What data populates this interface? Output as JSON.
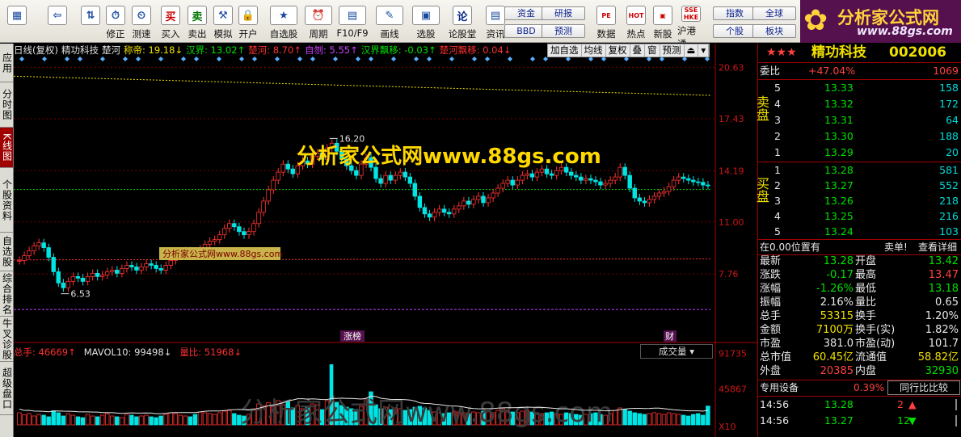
{
  "toolbar": {
    "buttons": [
      {
        "label": "",
        "icon": "grid-icon"
      },
      {
        "label": "",
        "icon": "back-arrow-icon"
      },
      {
        "label": "",
        "icon": "up-down-arrows-icon"
      },
      {
        "label": "修正",
        "icon": "clock-icon"
      },
      {
        "label": "测速",
        "icon": "stopwatch-icon"
      },
      {
        "label": "买入",
        "icon": "buy-icon",
        "glyph": "买"
      },
      {
        "label": "卖出",
        "icon": "sell-icon",
        "glyph": "卖"
      },
      {
        "label": "模拟",
        "icon": "hammer-icon"
      },
      {
        "label": "开户",
        "icon": "lock-icon"
      },
      {
        "label": "自选股",
        "icon": "star-icon"
      },
      {
        "label": "周期",
        "icon": "clock-icon"
      },
      {
        "label": "F10/F9",
        "icon": "f10-icon"
      },
      {
        "label": "画线",
        "icon": "pencil-icon"
      },
      {
        "label": "选股",
        "icon": "picture-icon"
      },
      {
        "label": "论股堂",
        "icon": "discuss-icon",
        "glyph": "论"
      },
      {
        "label": "资讯",
        "icon": "document-icon"
      }
    ],
    "small_buttons": [
      "资金",
      "BBD",
      "研报",
      "预测",
      "指数",
      "个股",
      "全球",
      "板块"
    ],
    "big_buttons_2": [
      {
        "label": "数据",
        "icon": "pe-icon",
        "glyph": "PE"
      },
      {
        "label": "热点",
        "icon": "hot-icon",
        "glyph": "HOT"
      },
      {
        "label": "新股",
        "icon": "new-icon"
      },
      {
        "label": "沪港通",
        "icon": "sse-hke-icon",
        "glyph": "SSE HKE"
      }
    ],
    "logo_title": "分析家公式网",
    "logo_url": "www.88gs.com"
  },
  "sidetabs": [
    "应用",
    "分时图",
    "K线图",
    "个股资料",
    "自选股",
    "综合排名",
    "牛叉诊股",
    "超级盘口"
  ],
  "chart": {
    "title_items": [
      {
        "text": "日线(复权)",
        "color": "#e0e0e0"
      },
      {
        "text": "精功科技",
        "color": "#e0e0e0"
      },
      {
        "text": "楚河",
        "color": "#e8e8e8"
      },
      {
        "text": "称帝: 19.18↓",
        "color": "#f0e000"
      },
      {
        "text": "汉界: 13.02↑",
        "color": "#00e000"
      },
      {
        "text": "楚河: 8.70↑",
        "color": "#ff3030"
      },
      {
        "text": "自刎: 5.55↑",
        "color": "#d040ff"
      },
      {
        "text": "汉界飘移: -0.03↑",
        "color": "#00e000"
      },
      {
        "text": "楚河飘移: 0.04↓",
        "color": "#ff3030"
      }
    ],
    "tools": [
      "加自选",
      "均线",
      "复权",
      "叠",
      "窗",
      "预测",
      "⏏",
      "▾"
    ],
    "price_labels": [
      "20.63",
      "17.43",
      "14.19",
      "11.00",
      "7.76"
    ],
    "high_label": "16.20",
    "low_label": "6.53",
    "watermark": "分析家公式网www.88gs.com",
    "watermark_small": "分析家公式网www.88gs.com",
    "watermark_vol": "分析家公式网www.88gs.com",
    "tag_zhangbang": "涨榜",
    "tag_cai": "财",
    "vol_legend": [
      {
        "text": "总手: 46669↑",
        "color": "#ff3030"
      },
      {
        "text": "MAVOL10: 99498↓",
        "color": "#e0e0e0"
      },
      {
        "text": "量比: 51968↓",
        "color": "#ff3030"
      }
    ],
    "vol_dropdown": "成交量",
    "vol_labels": [
      "91735",
      "45867",
      "X10"
    ],
    "colors": {
      "up": "#ff3232",
      "down": "#00e4e4",
      "grid": "#7a0000"
    }
  },
  "chart_data": {
    "type": "candlestick",
    "price_ticks": [
      20.63,
      17.43,
      14.19,
      11.0,
      7.76
    ],
    "high": 16.2,
    "low": 6.53,
    "lines": [
      {
        "name": "称帝",
        "value": 19.18
      },
      {
        "name": "汉界",
        "value": 13.02
      },
      {
        "name": "楚河",
        "value": 8.7
      },
      {
        "name": "自刎",
        "value": 5.55
      }
    ],
    "close": [
      8.6,
      8.9,
      9.2,
      9.5,
      9.7,
      9.4,
      8.8,
      7.9,
      7.2,
      6.9,
      7.3,
      7.6,
      7.5,
      7.3,
      7.6,
      7.8,
      7.6,
      7.7,
      7.9,
      8.0,
      7.8,
      8.1,
      8.3,
      8.2,
      8.0,
      8.2,
      8.4,
      8.3,
      8.1,
      8.0,
      8.3,
      8.6,
      8.9,
      9.1,
      9.2,
      9.0,
      8.9,
      9.3,
      9.6,
      9.8,
      9.9,
      10.2,
      10.6,
      10.9,
      10.7,
      10.4,
      10.2,
      10.4,
      10.9,
      11.6,
      12.3,
      13.0,
      13.6,
      14.1,
      14.6,
      14.3,
      14.0,
      14.5,
      14.8,
      14.6,
      15.1,
      15.3,
      14.9,
      15.6,
      15.9,
      15.4,
      14.9,
      14.5,
      14.2,
      13.9,
      14.6,
      15.0,
      14.4,
      13.7,
      13.4,
      13.9,
      13.6,
      13.9,
      14.1,
      13.8,
      13.4,
      12.6,
      11.9,
      11.5,
      11.3,
      11.6,
      11.8,
      11.6,
      11.5,
      11.8,
      12.0,
      12.3,
      12.1,
      12.4,
      12.6,
      12.2,
      12.5,
      12.8,
      13.1,
      13.4,
      13.6,
      13.3,
      13.6,
      13.9,
      14.0,
      13.8,
      14.1,
      14.3,
      14.0,
      13.9,
      14.2,
      14.4,
      14.1,
      13.9,
      13.8,
      13.6,
      13.7,
      13.6,
      13.5,
      13.3,
      13.4,
      13.6,
      13.8,
      14.4,
      13.9,
      13.1,
      12.5,
      12.3,
      12.2,
      12.4,
      12.6,
      12.8,
      12.9,
      13.2,
      13.6,
      13.8,
      13.7,
      13.6,
      13.5,
      13.47,
      13.3,
      13.28
    ],
    "volume": [
      30000,
      25000,
      28000,
      22000,
      26000,
      24000,
      20000,
      35000,
      30000,
      22000,
      28000,
      24000,
      20000,
      18000,
      26000,
      22000,
      20000,
      24000,
      28000,
      22000,
      20000,
      18000,
      26000,
      24000,
      20000,
      22000,
      24000,
      20000,
      18000,
      22000,
      26000,
      30000,
      28000,
      24000,
      22000,
      20000,
      26000,
      32000,
      30000,
      28000,
      26000,
      30000,
      34000,
      36000,
      28000,
      24000,
      22000,
      26000,
      40000,
      52000,
      48000,
      55000,
      45000,
      60000,
      50000,
      58000,
      42000,
      48000,
      40000,
      45000,
      52000,
      50000,
      38000,
      60000,
      72000,
      56000,
      48000,
      44000,
      40000,
      38000,
      46000,
      64000,
      82000,
      50000,
      40000,
      44000,
      38000,
      42000,
      40000,
      36000,
      38000,
      44000,
      46000,
      42000,
      36000,
      32000,
      30000,
      28000,
      30000,
      34000,
      32000,
      30000,
      28000,
      32000,
      30000,
      34000,
      32000,
      30000,
      36000,
      40000,
      34000,
      32000,
      30000,
      34000,
      36000,
      32000,
      30000,
      28000,
      30000,
      32000,
      28000,
      26000,
      30000,
      28000,
      26000,
      24000,
      26000,
      28000,
      30000,
      26000,
      24000,
      28000,
      36000,
      42000,
      38000,
      34000,
      30000,
      28000,
      26000,
      28000,
      30000,
      28000,
      26000,
      30000,
      28000,
      26000,
      24000,
      22000,
      26000,
      28000,
      24000,
      46669
    ],
    "vol_ticks": [
      91735,
      45867
    ],
    "vol_peak": 180000
  },
  "right": {
    "stars": "★★★",
    "stock_name": "精功科技",
    "stock_code": "002006",
    "weibi_label": "委比",
    "weibi_value": "+47.04%",
    "weibi_diff": "1069",
    "sell_side_label": "卖盘",
    "buy_side_label": "买盘",
    "sell_orders": [
      {
        "level": "5",
        "price": "13.33",
        "volume": "158"
      },
      {
        "level": "4",
        "price": "13.32",
        "volume": "172"
      },
      {
        "level": "3",
        "price": "13.31",
        "volume": "64"
      },
      {
        "level": "2",
        "price": "13.30",
        "volume": "188"
      },
      {
        "level": "1",
        "price": "13.29",
        "volume": "20"
      }
    ],
    "buy_orders": [
      {
        "level": "1",
        "price": "13.28",
        "volume": "581"
      },
      {
        "level": "2",
        "price": "13.27",
        "volume": "552"
      },
      {
        "level": "3",
        "price": "13.26",
        "volume": "218"
      },
      {
        "level": "4",
        "price": "13.25",
        "volume": "216"
      },
      {
        "level": "5",
        "price": "13.24",
        "volume": "103"
      }
    ],
    "position_text": "在0.00位置有",
    "sell_single_link": "卖单!",
    "detail_link": "查看详细",
    "stats": [
      {
        "l1": "最新",
        "v1": "13.28",
        "c1": "green",
        "l2": "开盘",
        "v2": "13.42",
        "c2": "green"
      },
      {
        "l1": "涨跌",
        "v1": "-0.17",
        "c1": "green",
        "l2": "最高",
        "v2": "13.47",
        "c2": "red"
      },
      {
        "l1": "涨幅",
        "v1": "-1.26%",
        "c1": "green",
        "l2": "最低",
        "v2": "13.18",
        "c2": "green"
      },
      {
        "l1": "振幅",
        "v1": "2.16%",
        "c1": "white",
        "l2": "量比",
        "v2": "0.65",
        "c2": "white"
      },
      {
        "l1": "总手",
        "v1": "53315",
        "c1": "yellow",
        "l2": "换手",
        "v2": "1.20%",
        "c2": "white"
      },
      {
        "l1": "金额",
        "v1": "7100万",
        "c1": "yellow",
        "l2": "换手(实)",
        "v2": "1.82%",
        "c2": "white"
      },
      {
        "l1": "市盈",
        "v1": "381.0",
        "c1": "white",
        "l2": "市盈(动)",
        "v2": "101.7",
        "c2": "white"
      },
      {
        "l1": "总市值",
        "v1": "60.45亿",
        "c1": "yellow",
        "l2": "流通值",
        "v2": "58.82亿",
        "c2": "yellow"
      },
      {
        "l1": "外盘",
        "v1": "20385",
        "c1": "red",
        "l2": "内盘",
        "v2": "32930",
        "c2": "green"
      }
    ],
    "device_label": "专用设备",
    "device_pct": "0.39%",
    "compare_button": "同行比比较",
    "ticks": [
      {
        "time": "14:56",
        "price": "13.28",
        "vol": "2",
        "arrow": "▲"
      },
      {
        "time": "14:56",
        "price": "13.27",
        "vol": "12",
        "arrow": "▼"
      }
    ]
  }
}
